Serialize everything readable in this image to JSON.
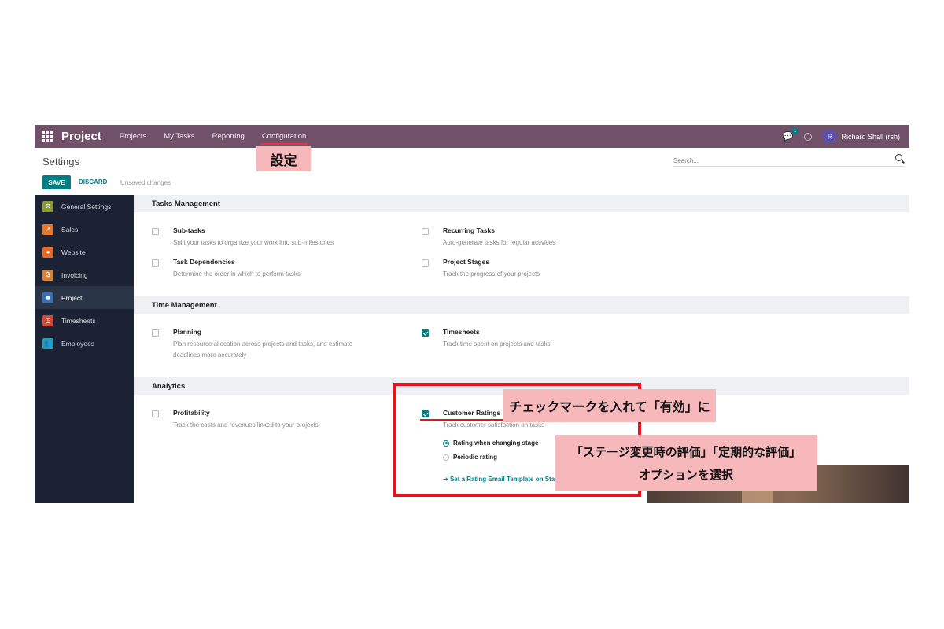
{
  "navbar": {
    "app_name": "Project",
    "menu": [
      "Projects",
      "My Tasks",
      "Reporting",
      "Configuration"
    ],
    "chat_badge": "1",
    "avatar_letter": "R",
    "user_name": "Richard Shall (rsh)"
  },
  "control": {
    "title": "Settings",
    "search_placeholder": "Search...",
    "save_label": "SAVE",
    "discard_label": "DISCARD",
    "status": "Unsaved changes"
  },
  "sidebar": {
    "items": [
      {
        "label": "General Settings",
        "icon": "settings-icon",
        "color": "#8a9a3a"
      },
      {
        "label": "Sales",
        "icon": "sales-chart-icon",
        "color": "#e0782f"
      },
      {
        "label": "Website",
        "icon": "website-globe-icon",
        "color": "#e06b2f"
      },
      {
        "label": "Invoicing",
        "icon": "invoice-icon",
        "color": "#d4823a"
      },
      {
        "label": "Project",
        "icon": "project-puzzle-icon",
        "color": "#3a6fb0"
      },
      {
        "label": "Timesheets",
        "icon": "stopwatch-icon",
        "color": "#d24a3a"
      },
      {
        "label": "Employees",
        "icon": "employees-icon",
        "color": "#2f9aa8"
      }
    ],
    "active_index": 4
  },
  "sections": {
    "tasks": {
      "title": "Tasks Management",
      "subtasks": {
        "title": "Sub-tasks",
        "desc": "Split your tasks to organize your work into sub-milestones",
        "checked": false
      },
      "recurring": {
        "title": "Recurring Tasks",
        "desc": "Auto-generate tasks for regular activities",
        "checked": false
      },
      "dependencies": {
        "title": "Task Dependencies",
        "desc": "Determine the order in which to perform tasks",
        "checked": false
      },
      "stages": {
        "title": "Project Stages",
        "desc": "Track the progress of your projects",
        "checked": false
      }
    },
    "time": {
      "title": "Time Management",
      "planning": {
        "title": "Planning",
        "desc1": "Plan resource allocation across projects and tasks, and estimate",
        "desc2": "deadlines more accurately",
        "checked": false
      },
      "timesheets": {
        "title": "Timesheets",
        "desc": "Track time spent on projects and tasks",
        "checked": true
      }
    },
    "analytics": {
      "title": "Analytics",
      "profitability": {
        "title": "Profitability",
        "desc": "Track the costs and revenues linked to your projects",
        "checked": false
      },
      "ratings": {
        "title": "Customer Ratings",
        "desc": "Track customer satisfaction on tasks",
        "checked": true,
        "option_stage": "Rating when changing stage",
        "option_periodic": "Periodic rating",
        "selected": "Rating when changing stage",
        "email_link": "Set a Rating Email Template on Stages"
      }
    }
  },
  "annotations": {
    "config": "設定",
    "check": "チェックマークを入れて「有効」に",
    "option_line1": "「ステージ変更時の評価」「定期的な評価」",
    "option_line2": "オプションを選択"
  }
}
